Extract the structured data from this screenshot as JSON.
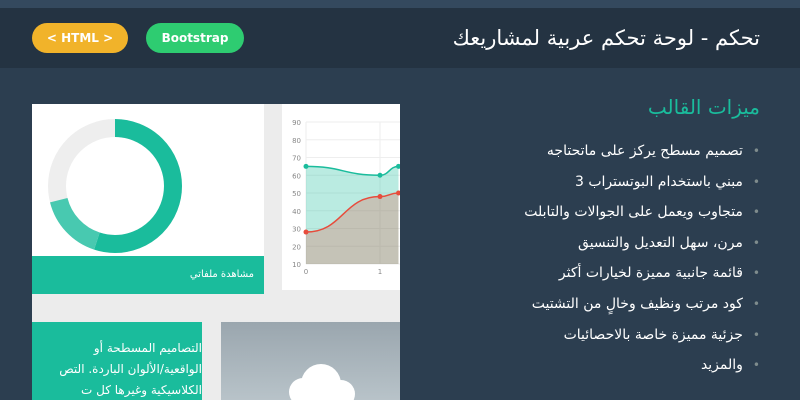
{
  "header": {
    "title": "تحكم - لوحة تحكم عربية لمشاريعك",
    "html_button": "< HTML >",
    "bootstrap_button": "Bootstrap"
  },
  "preview": {
    "donut_percent": 71,
    "donut_card_label": "مشاهدة ملفاتي",
    "text_card_lines": [
      "التصاميم المسطحة أو",
      "الواقعية/الألوان الباردة. التص",
      "الكلاسيكية وغيرها كل ت"
    ],
    "chart": {
      "y_ticks": [
        "90",
        "80",
        "70",
        "60",
        "50",
        "40",
        "30",
        "20",
        "10"
      ],
      "x_ticks": [
        "0",
        "1"
      ]
    }
  },
  "chart_data": {
    "type": "area",
    "x": [
      0,
      1,
      1.25
    ],
    "series": [
      {
        "values": [
          65,
          60,
          65
        ],
        "color": "#1abc9c"
      },
      {
        "values": [
          28,
          48,
          50
        ],
        "color": "#e74c3c"
      }
    ],
    "ylim": [
      10,
      90
    ],
    "xlabel": "",
    "ylabel": "",
    "grid": true
  },
  "features": {
    "heading": "ميزات القالب",
    "items": [
      "تصميم مسطح يركز على ماتحتاجه",
      "مبني باستخدام البوتستراب 3",
      "متجاوب ويعمل على الجوالات والتابلت",
      "مرن، سهل التعديل والتنسيق",
      "قائمة جانبية مميزة لخيارات أكثر",
      "كود مرتب ونظيف وخالٍ من التشتيت",
      "جزئية مميزة خاصة بالاحصائيات",
      "والمزيد"
    ]
  },
  "colors": {
    "accent": "#1abc9c",
    "background": "#2c3e50",
    "header": "#243342",
    "html_button": "#f1b32a",
    "bootstrap_button": "#2ecc71"
  }
}
